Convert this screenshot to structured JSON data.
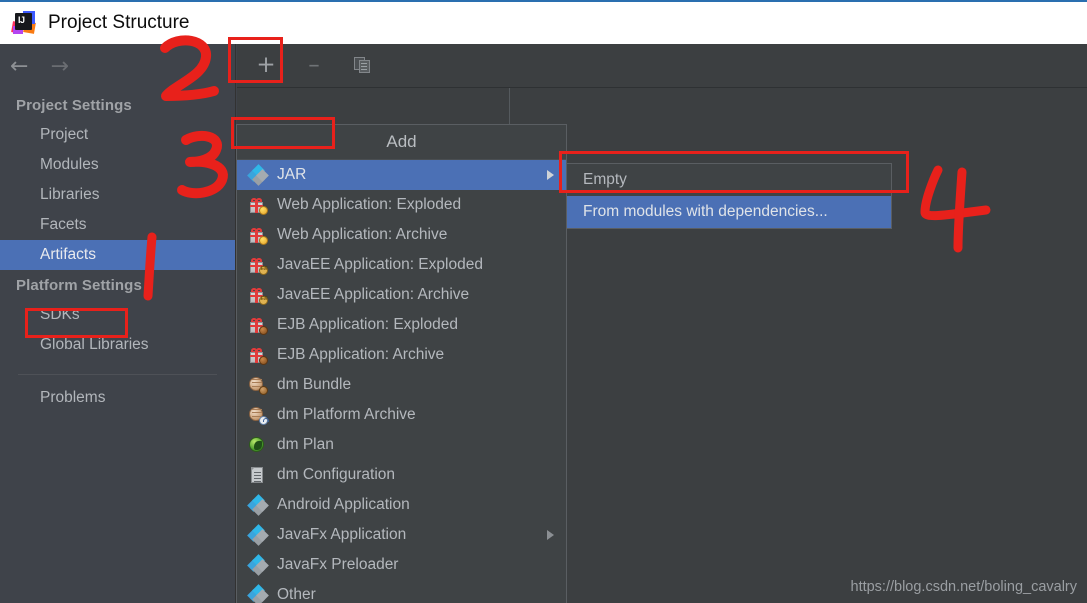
{
  "window": {
    "title": "Project Structure",
    "app_icon": "intellij-idea-icon"
  },
  "navigation": {
    "back_icon": "arrow-left-icon",
    "forward_icon": "arrow-right-icon"
  },
  "sidebar": {
    "groups": [
      {
        "label": "Project Settings",
        "items": [
          {
            "label": "Project",
            "selected": false
          },
          {
            "label": "Modules",
            "selected": false
          },
          {
            "label": "Libraries",
            "selected": false
          },
          {
            "label": "Facets",
            "selected": false
          },
          {
            "label": "Artifacts",
            "selected": true
          }
        ]
      },
      {
        "label": "Platform Settings",
        "items": [
          {
            "label": "SDKs",
            "selected": false
          },
          {
            "label": "Global Libraries",
            "selected": false
          }
        ]
      }
    ],
    "problems": {
      "label": "Problems",
      "selected": false
    }
  },
  "toolbar": {
    "add_label": "+",
    "remove_label": "–",
    "copy_icon": "copy-icon"
  },
  "menu": {
    "header": "Add",
    "items": [
      {
        "label": "JAR",
        "icon": "diamond",
        "selected": true,
        "submenu": true
      },
      {
        "label": "Web Application: Exploded",
        "icon": "gift-globe",
        "selected": false,
        "submenu": false
      },
      {
        "label": "Web Application: Archive",
        "icon": "gift-globe",
        "selected": false,
        "submenu": false
      },
      {
        "label": "JavaEE Application: Exploded",
        "icon": "gift-ee",
        "selected": false,
        "submenu": false
      },
      {
        "label": "JavaEE Application: Archive",
        "icon": "gift-ee",
        "selected": false,
        "submenu": false
      },
      {
        "label": "EJB Application: Exploded",
        "icon": "gift-bean",
        "selected": false,
        "submenu": false
      },
      {
        "label": "EJB Application: Archive",
        "icon": "gift-bean",
        "selected": false,
        "submenu": false
      },
      {
        "label": "dm Bundle",
        "icon": "dm-bundle",
        "selected": false,
        "submenu": false
      },
      {
        "label": "dm Platform Archive",
        "icon": "dm-platform",
        "selected": false,
        "submenu": false
      },
      {
        "label": "dm Plan",
        "icon": "plan-globe",
        "selected": false,
        "submenu": false
      },
      {
        "label": "dm Configuration",
        "icon": "document",
        "selected": false,
        "submenu": false
      },
      {
        "label": "Android Application",
        "icon": "diamond",
        "selected": false,
        "submenu": false
      },
      {
        "label": "JavaFx Application",
        "icon": "diamond",
        "selected": false,
        "submenu": true
      },
      {
        "label": "JavaFx Preloader",
        "icon": "diamond",
        "selected": false,
        "submenu": false
      },
      {
        "label": "Other",
        "icon": "diamond",
        "selected": false,
        "submenu": false
      }
    ]
  },
  "submenu": {
    "items": [
      {
        "label": "Empty",
        "selected": false
      },
      {
        "label": "From modules with dependencies...",
        "selected": true
      }
    ]
  },
  "watermark": "https://blog.csdn.net/boling_cavalry",
  "annotations": {
    "step1": "1",
    "step2": "2",
    "step3": "3",
    "step4": "4",
    "color": "#e8211b"
  },
  "colors": {
    "selection_blue": "#4b70b5",
    "panel_bg": "#3c3f41",
    "sidebar_bg": "#3f434a",
    "titlebar_bg": "#ffffff",
    "annotation_red": "#e8211b"
  }
}
